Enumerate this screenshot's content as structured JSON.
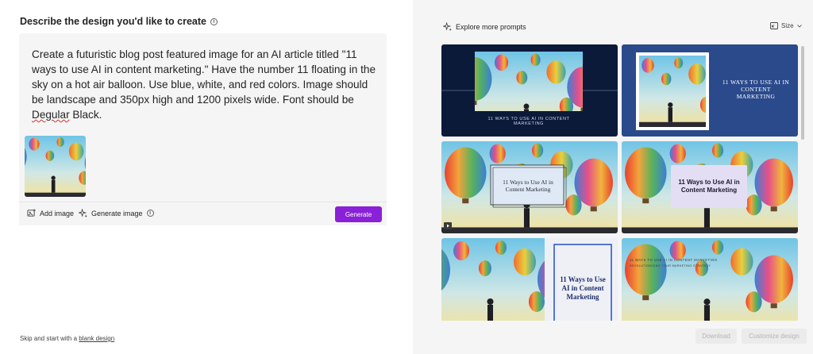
{
  "composer": {
    "heading": "Describe the design you'd like to create",
    "prompt_parts": [
      "Create a futuristic blog post featured image for an AI article titled \"11 ways to use AI in content marketing.\" Have the number 11 floating in the sky on a hot air balloon. Use blue, white, and red colors. Image should be landscape and 350px high and 1200 pixels wide. Font should be ",
      "Degular",
      " Black."
    ],
    "add_image_label": "Add image",
    "generate_image_label": "Generate image",
    "generate_button": "Generate"
  },
  "skip": {
    "text": "Skip and start with a ",
    "link": "blank design"
  },
  "gallery": {
    "explore_label": "Explore more prompts",
    "size_label": "Size",
    "cards": [
      {
        "caption": "11 WAYS TO USE AI IN CONTENT MARKETING",
        "style": "dark-navy"
      },
      {
        "caption": "11 WAYS TO USE AI IN CONTENT MARKETING",
        "style": "blue"
      },
      {
        "caption": "11 Ways to Use AI in Content Marketing",
        "style": "framed-serif"
      },
      {
        "caption": "11 Ways to Use AI in Content Marketing",
        "style": "lavender-box"
      },
      {
        "caption": "11 Ways to Use AI in Content Marketing",
        "style": "blue-border"
      },
      {
        "caption": "11 WAYS TO USE AI IN CONTENT MARKETING",
        "subcaption": "REVOLUTIONIZING YOUR MARKETING STRATEGY",
        "style": "top-text"
      }
    ],
    "download_button": "Download",
    "customize_button": "Customize design"
  },
  "colors": {
    "accent": "#8a20d8",
    "navy": "#0c1a3a",
    "card_blue": "#2b4a8c"
  },
  "icons": [
    "info-icon",
    "sparkle-icon",
    "add-image-icon",
    "resize-icon",
    "chevron-down-icon",
    "video-icon"
  ]
}
